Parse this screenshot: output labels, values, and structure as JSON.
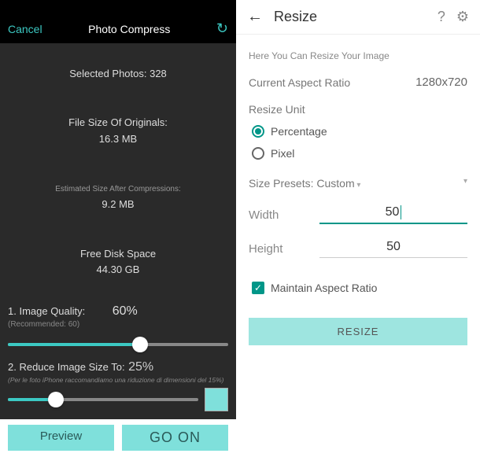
{
  "left": {
    "cancel": "Cancel",
    "title": "Photo Compress",
    "selected": "Selected Photos: 328",
    "orig_label": "File Size Of Originals:",
    "orig_value": "16.3 MB",
    "est_label": "Estimated Size After Compressions:",
    "est_value": "9.2 MB",
    "free_label": "Free Disk Space",
    "free_value": "44.30 GB",
    "quality_title": "1. Image Quality:",
    "quality_value": "60%",
    "quality_pct": 60,
    "quality_rec": "(Recommended: 60)",
    "reduce_title": "2. Reduce Image Size To:",
    "reduce_value": "25%",
    "reduce_pct": 25,
    "reduce_hint": "(Per le foto iPhone raccomandiamo una riduzione di dimensioni del 15%)",
    "preview": "Preview",
    "go": "GO ON"
  },
  "right": {
    "title": "Resize",
    "hint": "Here You Can Resize Your Image",
    "ratio_label": "Current Aspect Ratio",
    "ratio_value": "1280x720",
    "unit_label": "Resize Unit",
    "opt_percentage": "Percentage",
    "opt_pixel": "Pixel",
    "preset_label": "Size Presets:",
    "preset_value": "Custom",
    "width_label": "Width",
    "width_value": "50",
    "height_label": "Height",
    "height_value": "50",
    "maintain": "Maintain Aspect Ratio",
    "resize_btn": "RESIZE"
  }
}
